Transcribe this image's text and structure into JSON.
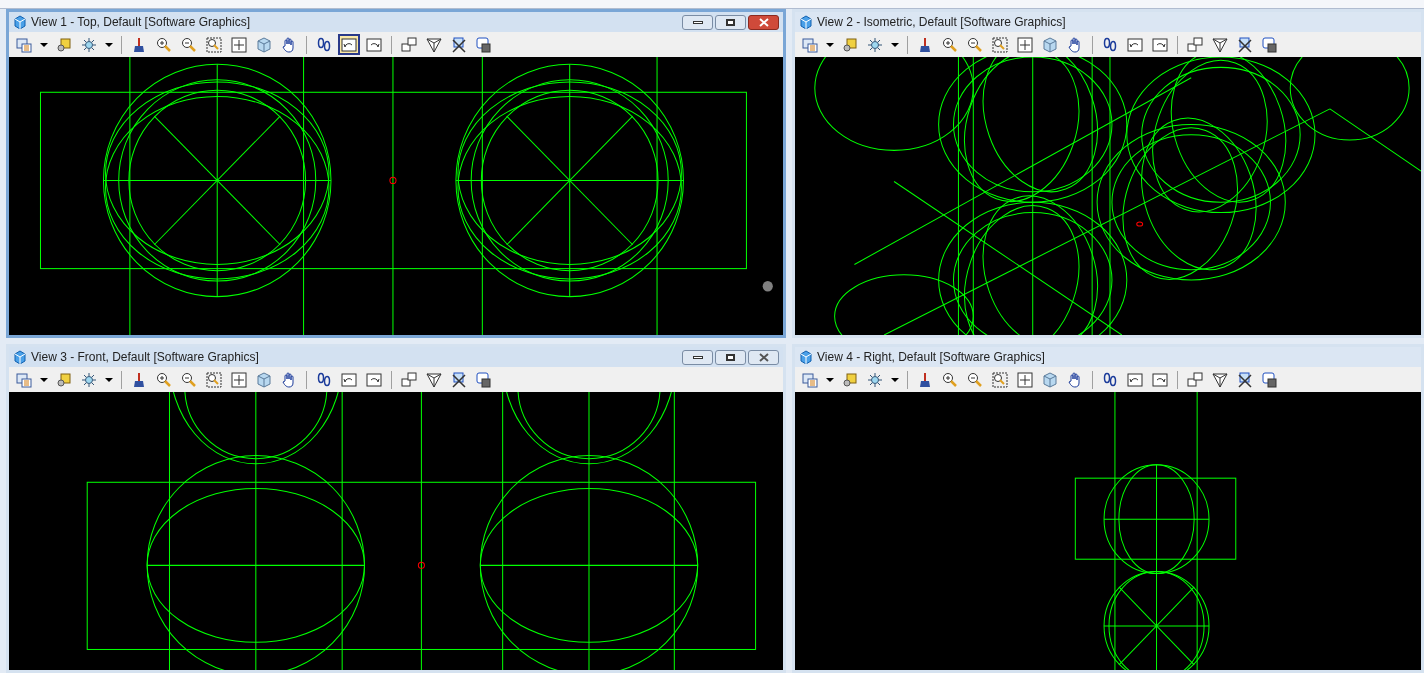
{
  "views": [
    {
      "title": "View 1 - Top, Default [Software Graphics]",
      "active": true,
      "window_controls": true,
      "kind": "top",
      "toolbar": [
        {
          "kind": "attributes",
          "selected": false
        },
        {
          "kind": "caret",
          "selected": false
        },
        {
          "kind": "style",
          "selected": false
        },
        {
          "kind": "light",
          "selected": false
        },
        {
          "kind": "caret",
          "selected": false
        },
        {
          "kind": "sep"
        },
        {
          "kind": "brush",
          "selected": false
        },
        {
          "kind": "zoomin",
          "selected": false
        },
        {
          "kind": "zoomout",
          "selected": false
        },
        {
          "kind": "window",
          "selected": false
        },
        {
          "kind": "fit",
          "selected": false
        },
        {
          "kind": "cube",
          "selected": false
        },
        {
          "kind": "hand",
          "selected": false
        },
        {
          "kind": "sep"
        },
        {
          "kind": "walk",
          "selected": false
        },
        {
          "kind": "prev",
          "selected": true
        },
        {
          "kind": "next",
          "selected": false
        },
        {
          "kind": "sep"
        },
        {
          "kind": "copy",
          "selected": false
        },
        {
          "kind": "clip",
          "selected": false
        },
        {
          "kind": "mask",
          "selected": false
        },
        {
          "kind": "camera",
          "selected": false
        }
      ]
    },
    {
      "title": "View 2 - Isometric, Default [Software Graphics]",
      "active": false,
      "window_controls": false,
      "kind": "iso",
      "toolbar": [
        {
          "kind": "attributes",
          "selected": false
        },
        {
          "kind": "caret",
          "selected": false
        },
        {
          "kind": "style",
          "selected": false
        },
        {
          "kind": "light",
          "selected": false
        },
        {
          "kind": "caret",
          "selected": false
        },
        {
          "kind": "sep"
        },
        {
          "kind": "brush",
          "selected": false
        },
        {
          "kind": "zoomin",
          "selected": false
        },
        {
          "kind": "zoomout",
          "selected": false
        },
        {
          "kind": "window",
          "selected": false
        },
        {
          "kind": "fit",
          "selected": false
        },
        {
          "kind": "cube",
          "selected": false
        },
        {
          "kind": "hand",
          "selected": false
        },
        {
          "kind": "sep"
        },
        {
          "kind": "walk",
          "selected": false
        },
        {
          "kind": "prev",
          "selected": false
        },
        {
          "kind": "next",
          "selected": false
        },
        {
          "kind": "sep"
        },
        {
          "kind": "copy",
          "selected": false
        },
        {
          "kind": "clip",
          "selected": false
        },
        {
          "kind": "mask",
          "selected": false
        },
        {
          "kind": "camera",
          "selected": false
        }
      ]
    },
    {
      "title": "View 3 - Front, Default [Software Graphics]",
      "active": false,
      "window_controls": true,
      "kind": "front",
      "toolbar": [
        {
          "kind": "attributes",
          "selected": false
        },
        {
          "kind": "caret",
          "selected": false
        },
        {
          "kind": "style",
          "selected": false
        },
        {
          "kind": "light",
          "selected": false
        },
        {
          "kind": "caret",
          "selected": false
        },
        {
          "kind": "sep"
        },
        {
          "kind": "brush",
          "selected": false
        },
        {
          "kind": "zoomin",
          "selected": false
        },
        {
          "kind": "zoomout",
          "selected": false
        },
        {
          "kind": "window",
          "selected": false
        },
        {
          "kind": "fit",
          "selected": false
        },
        {
          "kind": "cube",
          "selected": false
        },
        {
          "kind": "hand",
          "selected": false
        },
        {
          "kind": "sep"
        },
        {
          "kind": "walk",
          "selected": false
        },
        {
          "kind": "prev",
          "selected": false
        },
        {
          "kind": "next",
          "selected": false
        },
        {
          "kind": "sep"
        },
        {
          "kind": "copy",
          "selected": false
        },
        {
          "kind": "clip",
          "selected": false
        },
        {
          "kind": "mask",
          "selected": false
        },
        {
          "kind": "camera",
          "selected": false
        }
      ]
    },
    {
      "title": "View 4 - Right, Default [Software Graphics]",
      "active": false,
      "window_controls": false,
      "kind": "right",
      "toolbar": [
        {
          "kind": "attributes",
          "selected": false
        },
        {
          "kind": "caret",
          "selected": false
        },
        {
          "kind": "style",
          "selected": false
        },
        {
          "kind": "light",
          "selected": false
        },
        {
          "kind": "caret",
          "selected": false
        },
        {
          "kind": "sep"
        },
        {
          "kind": "brush",
          "selected": false
        },
        {
          "kind": "zoomin",
          "selected": false
        },
        {
          "kind": "zoomout",
          "selected": false
        },
        {
          "kind": "window",
          "selected": false
        },
        {
          "kind": "fit",
          "selected": false
        },
        {
          "kind": "cube",
          "selected": false
        },
        {
          "kind": "hand",
          "selected": false
        },
        {
          "kind": "sep"
        },
        {
          "kind": "walk",
          "selected": false
        },
        {
          "kind": "prev",
          "selected": false
        },
        {
          "kind": "next",
          "selected": false
        },
        {
          "kind": "sep"
        },
        {
          "kind": "copy",
          "selected": false
        },
        {
          "kind": "clip",
          "selected": false
        },
        {
          "kind": "mask",
          "selected": false
        },
        {
          "kind": "camera",
          "selected": false
        }
      ]
    }
  ]
}
